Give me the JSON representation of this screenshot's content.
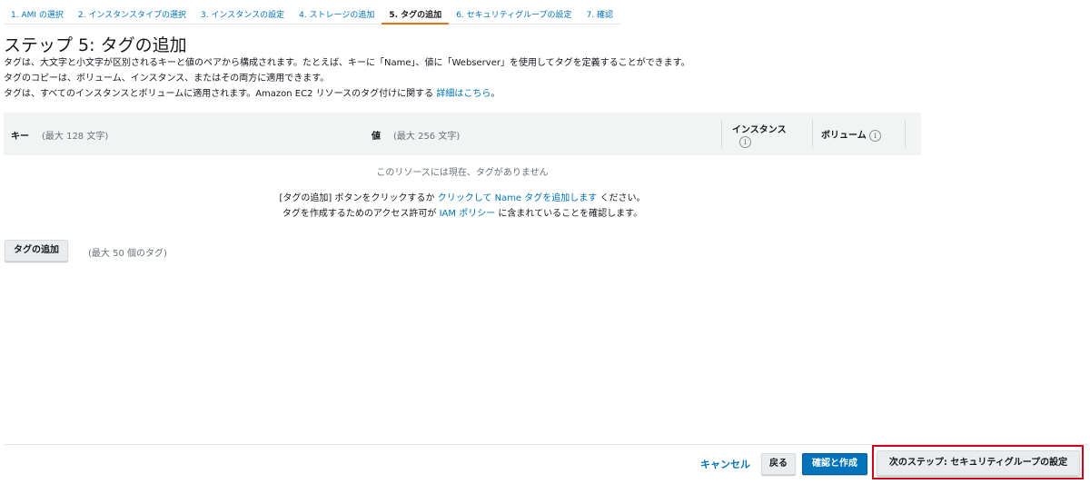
{
  "steps": [
    {
      "label": "1. AMI の選択"
    },
    {
      "label": "2. インスタンスタイプの選択"
    },
    {
      "label": "3. インスタンスの設定"
    },
    {
      "label": "4. ストレージの追加"
    },
    {
      "label": "5. タグの追加"
    },
    {
      "label": "6. セキュリティグループの設定"
    },
    {
      "label": "7. 確認"
    }
  ],
  "page": {
    "title": "ステップ 5: タグの追加",
    "desc1": "タグは、大文字と小文字が区別されるキーと値のペアから構成されます。たとえば、キーに「Name」、値に「Webserver」を使用してタグを定義することができます。",
    "desc2": "タグのコピーは、ボリューム、インスタンス、またはその両方に適用できます。",
    "desc3_prefix": "タグは、すべてのインスタンスとボリュームに適用されます。Amazon EC2 リソースのタグ付けに関する",
    "desc3_link": "詳細はこちら",
    "desc3_suffix": "。"
  },
  "table": {
    "key_label": "キー",
    "key_hint": "(最大 128 文字)",
    "value_label": "値",
    "value_hint": "(最大 256 文字)",
    "instances_label": "インスタンス",
    "volumes_label": "ボリューム",
    "info_glyph": "i",
    "empty_text": "このリソースには現在、タグがありません",
    "msg1_prefix": "[タグの追加] ボタンをクリックするか",
    "msg1_link": "クリックして Name タグを追加します",
    "msg1_suffix": "ください。",
    "msg2_prefix": "タグを作成するためのアクセス許可が",
    "msg2_link": "IAM ポリシー",
    "msg2_suffix": "に含まれていることを確認します。"
  },
  "add_tag": {
    "button_label": "タグの追加",
    "max_text": "(最大 50 個のタグ)"
  },
  "footer": {
    "cancel": "キャンセル",
    "back": "戻る",
    "review_launch": "確認と作成",
    "next": "次のステップ: セキュリティグループの設定"
  },
  "colors": {
    "link": "#0073bb",
    "active_tab": "#ec7211",
    "primary_button": "#0073bb",
    "highlight_box": "#d0021b"
  }
}
